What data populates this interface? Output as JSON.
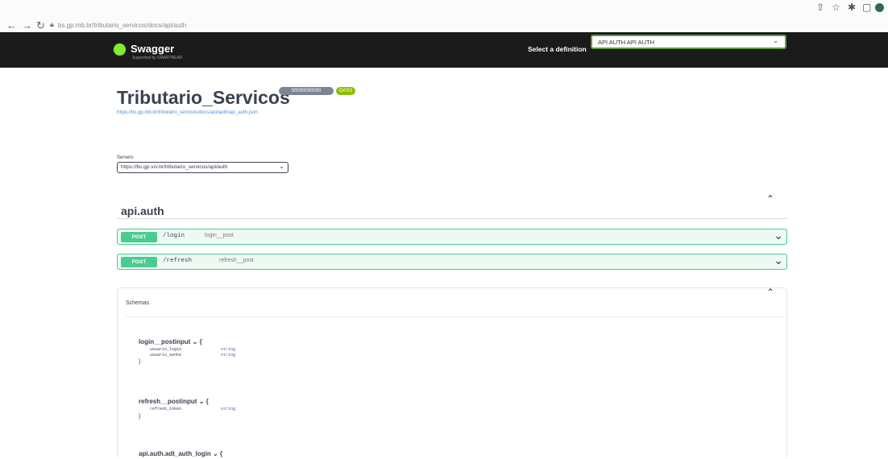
{
  "browser": {
    "back_icon": "arrow-left-icon",
    "forward_icon": "arrow-right-icon",
    "reload_icon": "reload-icon",
    "url": "bs.gp.mb.br/tributario_servicos/docs/api/auth"
  },
  "topbar": {
    "logo_text": "Swagger",
    "logo_sub": "Supported by SMARTBEAR",
    "definition_label": "Select a definition",
    "definition_value": "API AUTH API AUTH"
  },
  "info": {
    "title": "Tributario_Servicos",
    "version_badge": "00000000000",
    "oas_badge": "OAS3",
    "base_url": "https://bs.gp.mb.br/tributario_servicos/docs/api/auth/api_auth.json"
  },
  "servers": {
    "label": "Servers",
    "value": "https://bs.gp.srv.br/tributario_servicos/api/auth"
  },
  "tag": {
    "name": "api.auth",
    "operations": [
      {
        "method": "POST",
        "path": "/login",
        "summary": "login__post"
      },
      {
        "method": "POST",
        "path": "/refresh",
        "summary": "refresh__post"
      }
    ]
  },
  "models": {
    "label": "Schemas",
    "items": [
      {
        "name": "login__postinput",
        "properties": [
          {
            "name": "usuario_login",
            "type": "string"
          },
          {
            "name": "usuario_senha",
            "type": "string"
          }
        ]
      },
      {
        "name": "refresh__postinput",
        "properties": [
          {
            "name": "refresh_token",
            "type": "string"
          }
        ]
      },
      {
        "name": "api.auth.adt_auth_login",
        "properties": []
      }
    ]
  },
  "colors": {
    "post": "#49cc90",
    "topbar": "#1b1b1b",
    "link": "#4990e2"
  }
}
